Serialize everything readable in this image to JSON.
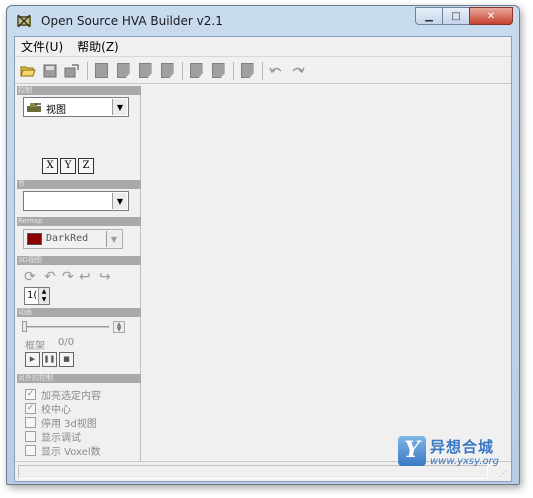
{
  "window": {
    "title": "Open Source HVA Builder v2.1",
    "minimize_glyph": "▁",
    "maximize_glyph": "□",
    "close_glyph": "✕"
  },
  "menu": {
    "items": [
      {
        "label": "文件(U)"
      },
      {
        "label": "帮助(Z)"
      }
    ]
  },
  "toolbar": {
    "icons": [
      "open-folder-icon",
      "save-icon",
      "export-icon",
      "doc-icon",
      "doc-edit-icon",
      "doc-icon",
      "doc-icon",
      "doc-icon",
      "doc-icon",
      "doc-icon",
      "undo-icon",
      "redo-icon"
    ]
  },
  "panel": {
    "sections": {
      "control": "控制",
      "section": "节",
      "remap": "Remap",
      "view3d": "3D视图",
      "animation": "动画",
      "advanced": "另外的控制"
    },
    "view_combo": {
      "value": "视图"
    },
    "axes": [
      "X",
      "Y",
      "Z"
    ],
    "section_combo": {
      "value": ""
    },
    "remap_combo": {
      "value": "DarkRed",
      "swatch_color": "#8b0000"
    },
    "spin_value": "1(",
    "frame_label": "框架",
    "frame_value": "0/0",
    "checks": [
      {
        "label": "加亮选定内容",
        "checked": true
      },
      {
        "label": "校中心",
        "checked": true
      },
      {
        "label": "停用  3d视图",
        "checked": false
      },
      {
        "label": "显示调试",
        "checked": false
      },
      {
        "label": "显示  Voxel数",
        "checked": false
      }
    ]
  },
  "watermark": {
    "letter": "Y",
    "title": "异想合城",
    "url": "www.yxsy.org"
  },
  "colors": {
    "accent": "#3a78c4",
    "section_header": "#a9a9a9"
  }
}
